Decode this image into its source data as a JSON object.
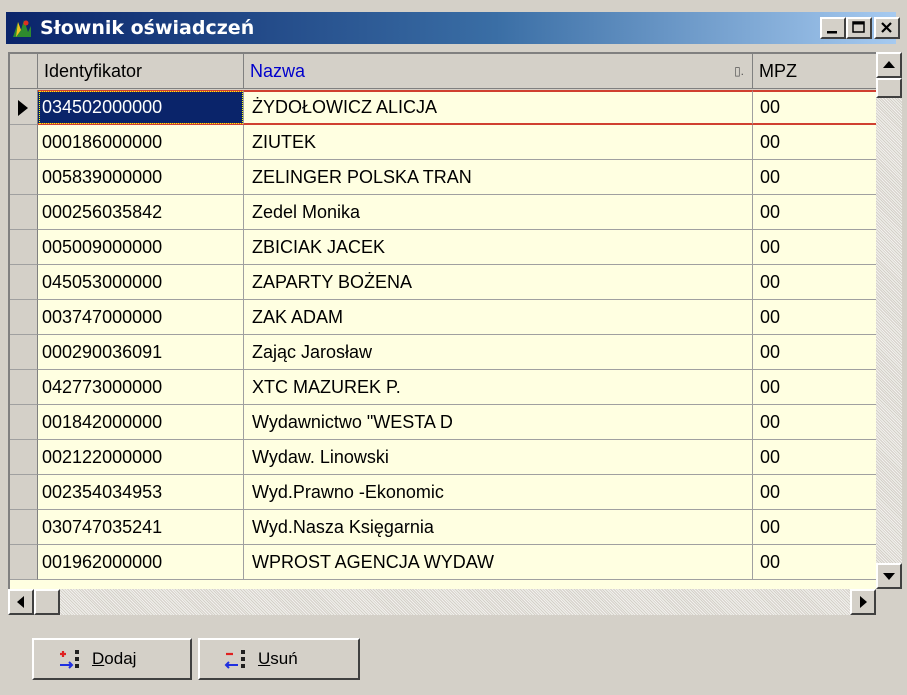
{
  "window": {
    "title": "Słownik oświadczeń"
  },
  "grid": {
    "columns": [
      {
        "key": "id",
        "label": "Identyfikator"
      },
      {
        "key": "nazwa",
        "label": "Nazwa",
        "sort_indicator": "▯."
      },
      {
        "key": "mpz",
        "label": "MPZ"
      }
    ],
    "rows": [
      {
        "id": "034502000000",
        "nazwa": "ŻYDOŁOWICZ ALICJA",
        "mpz": "00"
      },
      {
        "id": "000186000000",
        "nazwa": "ZIUTEK",
        "mpz": "00"
      },
      {
        "id": "005839000000",
        "nazwa": "ZELINGER POLSKA TRAN",
        "mpz": "00"
      },
      {
        "id": "000256035842",
        "nazwa": "Zedel Monika",
        "mpz": "00"
      },
      {
        "id": "005009000000",
        "nazwa": "ZBICIAK JACEK",
        "mpz": "00"
      },
      {
        "id": "045053000000",
        "nazwa": "ZAPARTY BOŻENA",
        "mpz": "00"
      },
      {
        "id": "003747000000",
        "nazwa": "ZAK ADAM",
        "mpz": "00"
      },
      {
        "id": "000290036091",
        "nazwa": "Zając Jarosław",
        "mpz": "00"
      },
      {
        "id": "042773000000",
        "nazwa": "XTC MAZUREK P.",
        "mpz": "00"
      },
      {
        "id": "001842000000",
        "nazwa": "Wydawnictwo \"WESTA D",
        "mpz": "00"
      },
      {
        "id": "002122000000",
        "nazwa": "Wydaw. Linowski",
        "mpz": "00"
      },
      {
        "id": "002354034953",
        "nazwa": "Wyd.Prawno -Ekonomic",
        "mpz": "00"
      },
      {
        "id": "030747035241",
        "nazwa": "Wyd.Nasza Księgarnia",
        "mpz": "00"
      },
      {
        "id": "001962000000",
        "nazwa": "WPROST AGENCJA WYDAW",
        "mpz": "00"
      }
    ],
    "selected_row": 0
  },
  "buttons": {
    "dodaj": {
      "mnemonic": "D",
      "rest": "odaj"
    },
    "usun": {
      "mnemonic": "U",
      "rest": "suń"
    }
  },
  "colors": {
    "title_start": "#0A246A",
    "title_end": "#A6CAF0",
    "grid_background": "#FFFFE1",
    "selection": "#0A246A",
    "current_row_border": "#D04030",
    "sorted_header_text": "#0000CC"
  },
  "icons": {
    "app": "app-logo-icon",
    "add": "add-record-icon",
    "remove": "remove-record-icon"
  }
}
